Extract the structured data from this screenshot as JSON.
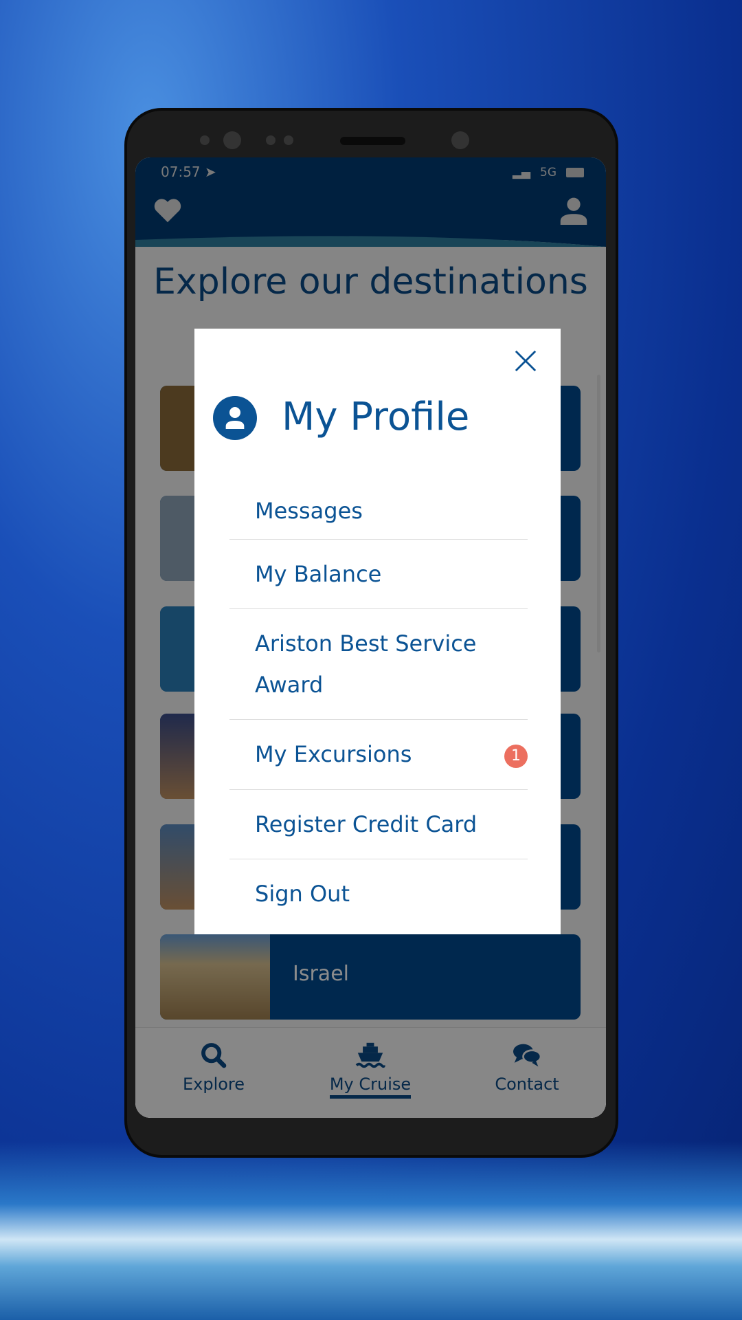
{
  "status": {
    "time": "07:57",
    "network": "5G"
  },
  "page": {
    "title": "Explore our destinations"
  },
  "destinations": [
    {
      "label": "",
      "color": "#8a6a3a"
    },
    {
      "label": "",
      "color": "#8fa5b8"
    },
    {
      "label": "",
      "color": "#2a7fb8"
    },
    {
      "label": "",
      "color": "#5a6c9a"
    },
    {
      "label": "",
      "color": "#c09060"
    },
    {
      "label": "Israel",
      "color": "#c8a870"
    }
  ],
  "modal": {
    "title": "My Profile",
    "items": [
      {
        "label": "Messages"
      },
      {
        "label": "My Balance"
      },
      {
        "label": "Ariston Best Service Award"
      },
      {
        "label": "My Excursions",
        "badge": "1"
      },
      {
        "label": "Register Credit Card"
      },
      {
        "label": "Sign Out"
      }
    ]
  },
  "nav": {
    "items": [
      {
        "label": "Explore",
        "icon": "search-icon"
      },
      {
        "label": "My Cruise",
        "icon": "ship-icon",
        "active": true
      },
      {
        "label": "Contact",
        "icon": "chat-icon"
      }
    ]
  },
  "colors": {
    "primary": "#0b5394",
    "header": "#003b73",
    "badge": "#ec6f5f"
  }
}
